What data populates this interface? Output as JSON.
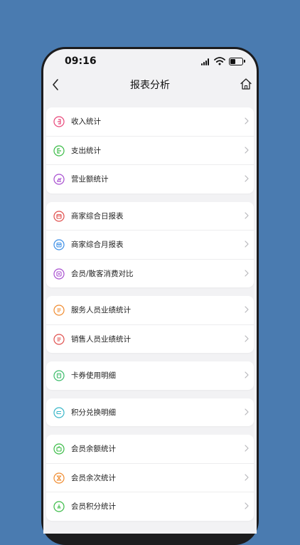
{
  "status_bar": {
    "time": "09:16"
  },
  "header": {
    "title": "报表分析"
  },
  "groups": [
    {
      "items": [
        {
          "label": "收入统计",
          "icon": "income-icon",
          "color": "#e8477a"
        },
        {
          "label": "支出统计",
          "icon": "expense-icon",
          "color": "#3cbc48"
        },
        {
          "label": "营业额统计",
          "icon": "revenue-icon",
          "color": "#a84fd0"
        }
      ]
    },
    {
      "items": [
        {
          "label": "商家综合日报表",
          "icon": "calendar-day-icon",
          "color": "#e0504e"
        },
        {
          "label": "商家综合月报表",
          "icon": "calendar-month-icon",
          "color": "#3d8fe6"
        },
        {
          "label": "会员/散客消费对比",
          "icon": "compare-icon",
          "color": "#a84fd0"
        }
      ]
    },
    {
      "items": [
        {
          "label": "服务人员业绩统计",
          "icon": "document-icon",
          "color": "#f08c30"
        },
        {
          "label": "销售人员业绩统计",
          "icon": "document-icon",
          "color": "#e0504e"
        }
      ]
    },
    {
      "items": [
        {
          "label": "卡券使用明细",
          "icon": "coupon-icon",
          "color": "#3cbc6a"
        }
      ]
    },
    {
      "items": [
        {
          "label": "积分兑换明细",
          "icon": "exchange-icon",
          "color": "#38b6c8"
        }
      ]
    },
    {
      "items": [
        {
          "label": "会员余额统计",
          "icon": "wallet-icon",
          "color": "#3cbc48"
        },
        {
          "label": "会员余次统计",
          "icon": "hourglass-icon",
          "color": "#f08c30"
        },
        {
          "label": "会员积分统计",
          "icon": "points-icon",
          "color": "#3cbc48"
        }
      ]
    }
  ]
}
